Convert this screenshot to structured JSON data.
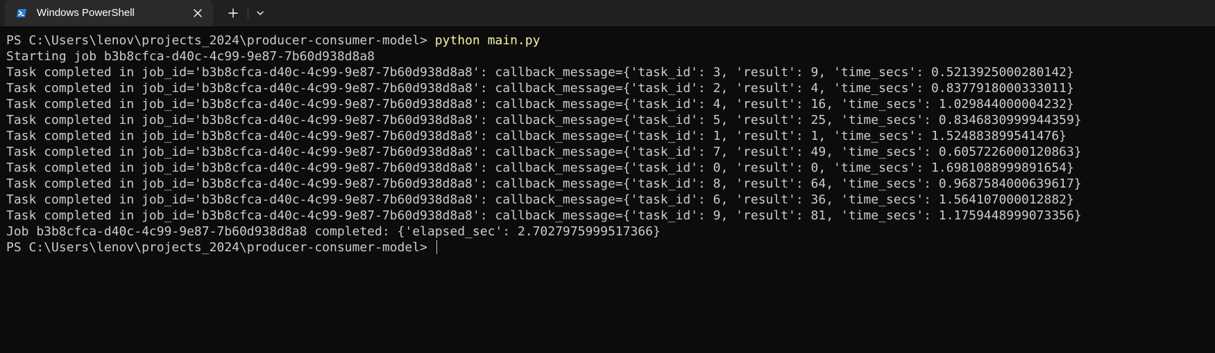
{
  "window": {
    "tab_title": "Windows PowerShell",
    "tab_icon": "powershell-icon"
  },
  "colors": {
    "background": "#0c0c0c",
    "foreground": "#cccccc",
    "command": "#f9f1a5",
    "titlebar": "#202020",
    "tab_active": "#2b2b2b"
  },
  "terminal": {
    "prompt": "PS C:\\Users\\lenov\\projects_2024\\producer-consumer-model> ",
    "command": "python main.py",
    "output": [
      "Starting job b3b8cfca-d40c-4c99-9e87-7b60d938d8a8",
      "Task completed in job_id='b3b8cfca-d40c-4c99-9e87-7b60d938d8a8': callback_message={'task_id': 3, 'result': 9, 'time_secs': 0.5213925000280142}",
      "Task completed in job_id='b3b8cfca-d40c-4c99-9e87-7b60d938d8a8': callback_message={'task_id': 2, 'result': 4, 'time_secs': 0.8377918000333011}",
      "Task completed in job_id='b3b8cfca-d40c-4c99-9e87-7b60d938d8a8': callback_message={'task_id': 4, 'result': 16, 'time_secs': 1.029844000004232}",
      "Task completed in job_id='b3b8cfca-d40c-4c99-9e87-7b60d938d8a8': callback_message={'task_id': 5, 'result': 25, 'time_secs': 0.8346830999944359}",
      "Task completed in job_id='b3b8cfca-d40c-4c99-9e87-7b60d938d8a8': callback_message={'task_id': 1, 'result': 1, 'time_secs': 1.524883899541476}",
      "Task completed in job_id='b3b8cfca-d40c-4c99-9e87-7b60d938d8a8': callback_message={'task_id': 7, 'result': 49, 'time_secs': 0.6057226000120863}",
      "Task completed in job_id='b3b8cfca-d40c-4c99-9e87-7b60d938d8a8': callback_message={'task_id': 0, 'result': 0, 'time_secs': 1.6981088999891654}",
      "Task completed in job_id='b3b8cfca-d40c-4c99-9e87-7b60d938d8a8': callback_message={'task_id': 8, 'result': 64, 'time_secs': 0.9687584000639617}",
      "Task completed in job_id='b3b8cfca-d40c-4c99-9e87-7b60d938d8a8': callback_message={'task_id': 6, 'result': 36, 'time_secs': 1.564107000012882}",
      "Task completed in job_id='b3b8cfca-d40c-4c99-9e87-7b60d938d8a8': callback_message={'task_id': 9, 'result': 81, 'time_secs': 1.1759448999073356}",
      "Job b3b8cfca-d40c-4c99-9e87-7b60d938d8a8 completed: {'elapsed_sec': 2.7027975999517366}"
    ],
    "final_prompt": "PS C:\\Users\\lenov\\projects_2024\\producer-consumer-model> "
  }
}
